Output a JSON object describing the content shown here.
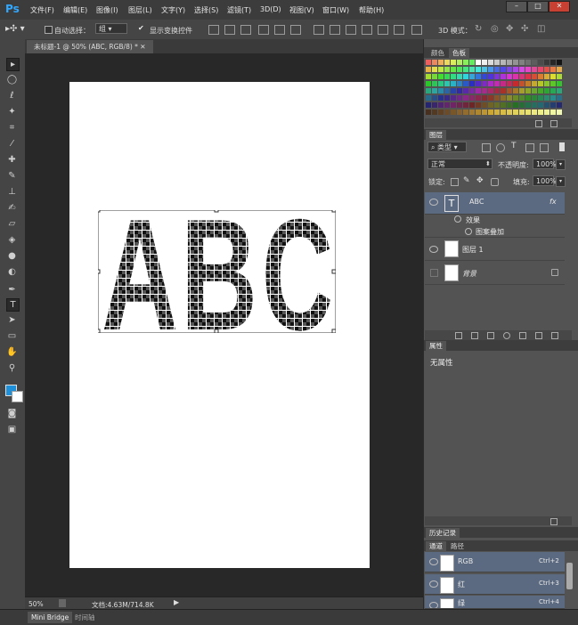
{
  "app": {
    "logo": "Ps"
  },
  "menu": {
    "items": [
      "文件(F)",
      "编辑(E)",
      "图像(I)",
      "图层(L)",
      "文字(Y)",
      "选择(S)",
      "滤镜(T)",
      "3D(D)",
      "视图(V)",
      "窗口(W)",
      "帮助(H)"
    ]
  },
  "window_controls": {
    "minimize": "–",
    "maximize": "□",
    "close": "✕"
  },
  "options": {
    "auto_select_label": "自动选择：",
    "auto_select_target": "组",
    "show_transform_label": "显示变换控件",
    "mode_3d_label": "3D 模式："
  },
  "document": {
    "tab_title": "未标题-1 @ 50% (ABC, RGB/8) *",
    "text": [
      "A",
      "B",
      "C"
    ]
  },
  "status": {
    "zoom": "50%",
    "doc_info": "文档:4.63M/714.8K"
  },
  "bottom_tabs": [
    "Mini Bridge",
    "时间轴"
  ],
  "panels": {
    "color_tabs": [
      "颜色",
      "色板"
    ],
    "layers": {
      "title": "图层",
      "filter_kind": "类型",
      "blend_mode": "正常",
      "opacity_label": "不透明度:",
      "opacity_value": "100%",
      "lock_label": "锁定:",
      "fill_label": "填充:",
      "fill_value": "100%",
      "items": [
        {
          "name": "ABC",
          "thumb": "T",
          "fx": "fx"
        },
        {
          "name": "效果"
        },
        {
          "name": "图案叠加"
        },
        {
          "name": "图层 1"
        },
        {
          "name": "背景"
        }
      ]
    },
    "properties": {
      "title": "属性",
      "content": "无属性"
    },
    "history": {
      "title": "历史记录"
    },
    "channels": {
      "tabs": [
        "通道",
        "路径"
      ],
      "items": [
        {
          "name": "RGB",
          "shortcut": "Ctrl+2"
        },
        {
          "name": "红",
          "shortcut": "Ctrl+3"
        },
        {
          "name": "绿",
          "shortcut": "Ctrl+4"
        }
      ]
    }
  },
  "colors": {
    "accent": "#1e8fd9",
    "ps_blue": "#31a8ff",
    "selected_layer": "#5b6a80"
  }
}
